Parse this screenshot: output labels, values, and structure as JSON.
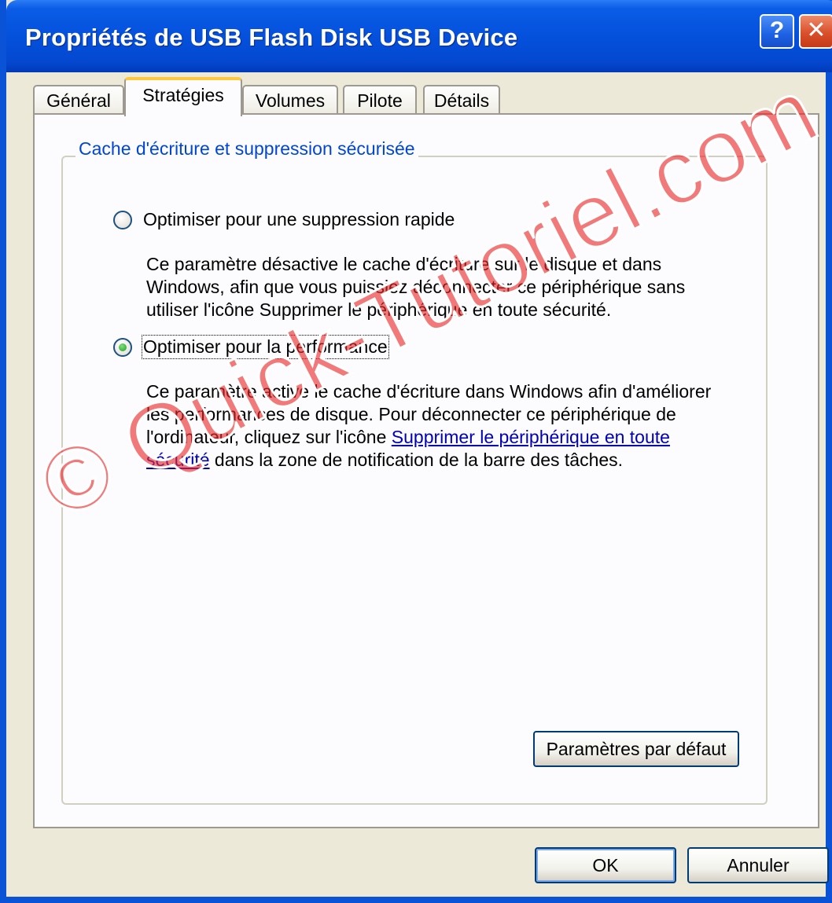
{
  "window": {
    "title": "Propriétés de USB Flash Disk USB Device",
    "help_glyph": "?",
    "close_glyph": "✕"
  },
  "tabs": [
    {
      "label": "Général",
      "active": false
    },
    {
      "label": "Stratégies",
      "active": true
    },
    {
      "label": "Volumes",
      "active": false
    },
    {
      "label": "Pilote",
      "active": false
    },
    {
      "label": "Détails",
      "active": false
    }
  ],
  "group": {
    "title": "Cache d'écriture et suppression sécurisée",
    "option_quick": {
      "label": "Optimiser pour une suppression rapide",
      "selected": false,
      "description": "Ce paramètre désactive le cache d'écriture sur le disque et dans Windows, afin que vous puissiez déconnecter ce périphérique sans utiliser l'icône Supprimer le périphérique en toute sécurité."
    },
    "option_perf": {
      "label": "Optimiser pour la performance",
      "selected": true,
      "desc_before": "Ce paramètre active le cache d'écriture dans Windows afin d'améliorer les performances de disque. Pour déconnecter ce périphérique de l'ordinateur, cliquez sur l'icône ",
      "desc_link": "Supprimer le périphérique en toute sécurité",
      "desc_after": " dans la zone de notification de la barre des tâches."
    },
    "defaults_button": "Paramètres par défaut"
  },
  "buttons": {
    "ok": "OK",
    "cancel": "Annuler"
  },
  "watermark": "© Quick-Tutoriel.com",
  "colors": {
    "titlebar": "#0451dc",
    "group_title": "#0046d5",
    "active_tab_accent": "#ffc83c",
    "link": "#0000b8",
    "watermark": "#ec2828"
  }
}
